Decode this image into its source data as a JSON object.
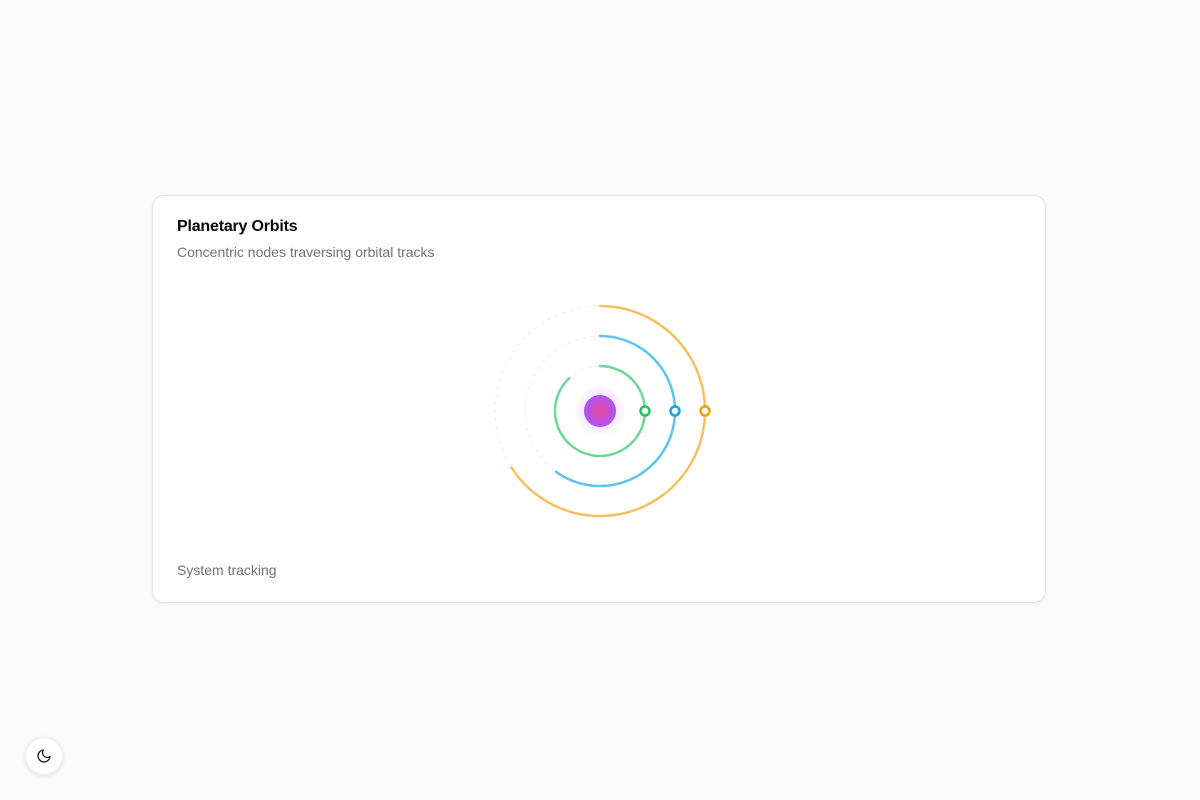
{
  "card": {
    "title": "Planetary Orbits",
    "subtitle": "Concentric nodes traversing orbital tracks",
    "footer": "System tracking"
  },
  "orbits": [
    {
      "name": "inner",
      "color": "#22c55e",
      "arc_progress": 0.88
    },
    {
      "name": "middle",
      "color": "#0ea5e9",
      "arc_progress": 0.6
    },
    {
      "name": "outer",
      "color": "#f59e0b",
      "arc_progress": 0.66
    }
  ],
  "colors": {
    "core_gradient": [
      "#ec4899",
      "#a855f7"
    ],
    "track": "#e5e7eb"
  },
  "theme_toggle": {
    "icon": "moon-icon"
  }
}
